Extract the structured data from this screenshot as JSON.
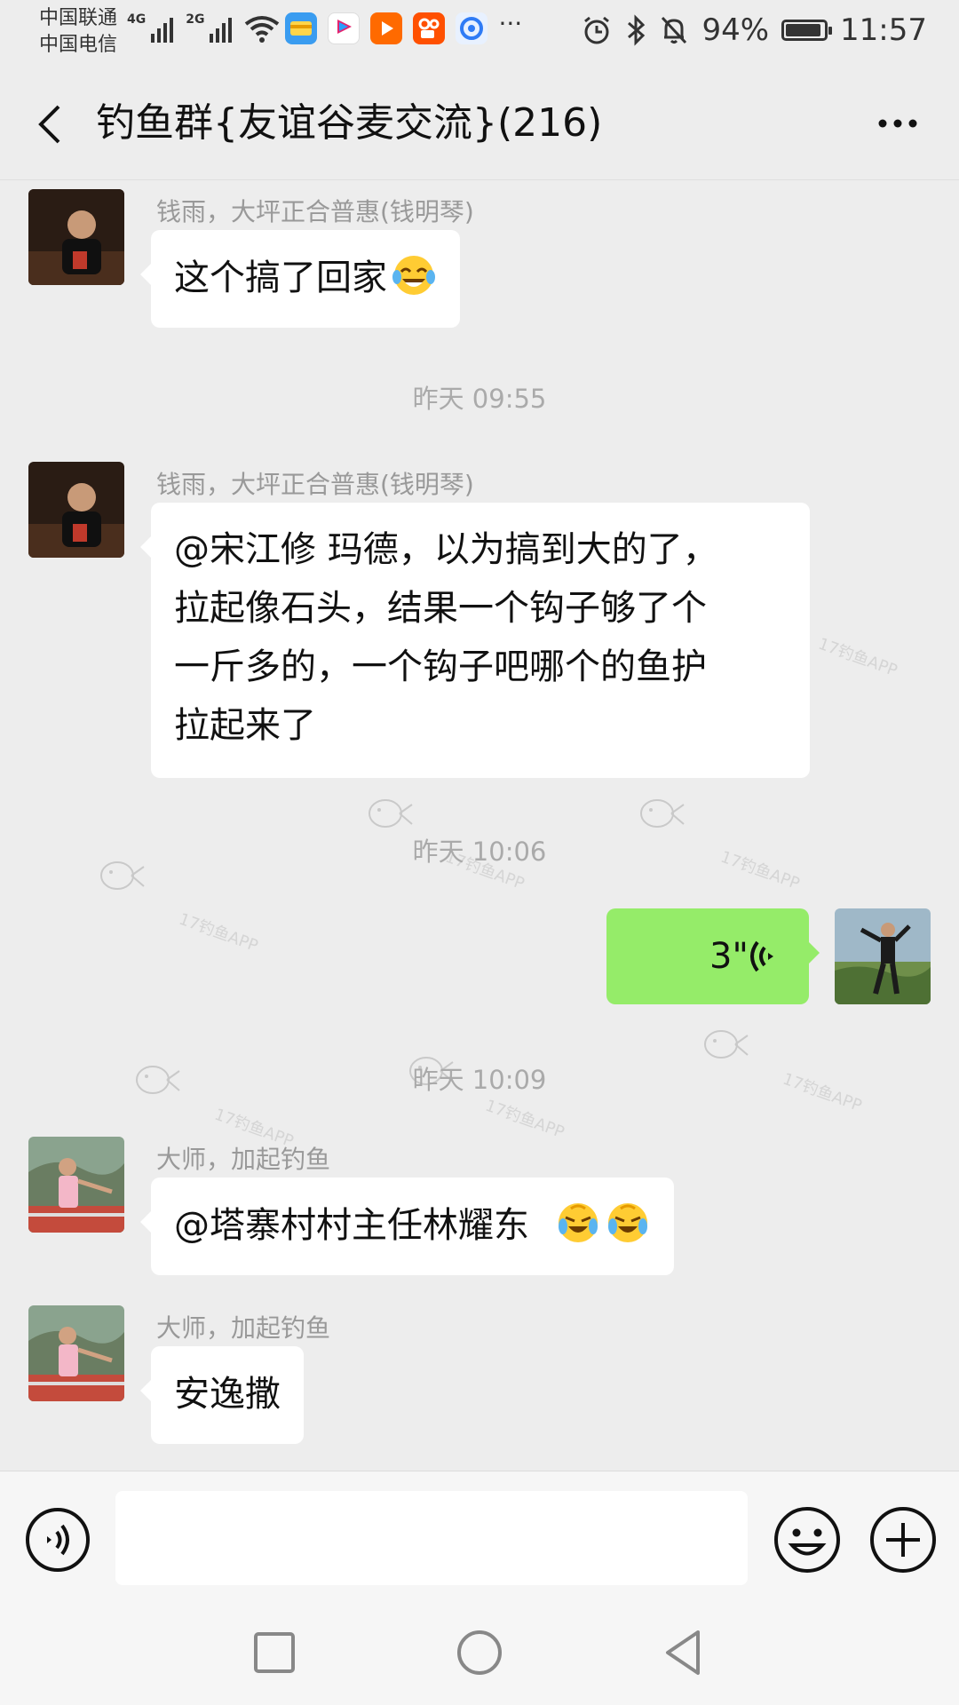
{
  "status_bar": {
    "carrier1": "中国联通",
    "carrier2": "中国电信",
    "net1": "4G",
    "net2": "2G",
    "battery_percent": "94%",
    "battery_level": 0.94,
    "time": "11:57",
    "more_notifications": "···"
  },
  "header": {
    "title": "钓鱼群{友谊谷麦交流}(216)"
  },
  "messages": [
    {
      "sender": "钱雨，大坪正合普惠(钱明琴)",
      "text": "这个搞了回家",
      "emoji": "tears-of-joy-emoji"
    },
    {
      "timestamp": "昨天 09:55"
    },
    {
      "sender": "钱雨，大坪正合普惠(钱明琴)",
      "lines": [
        "@宋江修  玛德，以为搞到大的了，",
        "拉起像石头，结果一个钩子够了个",
        "一斤多的，一个钩子吧哪个的鱼护",
        "拉起来了"
      ]
    },
    {
      "timestamp": "昨天 10:06"
    },
    {
      "outgoing_voice_duration": "3\""
    },
    {
      "timestamp": "昨天 10:09"
    },
    {
      "sender": "大师，加起钓鱼",
      "text": "@塔寨村村主任林耀东  ",
      "emoji": "loudly-crying-laughing-emoji"
    },
    {
      "sender": "大师，加起钓鱼",
      "text": "安逸撒"
    }
  ],
  "watermark": {
    "text": "17钓鱼APP"
  },
  "input_bar": {
    "value": "",
    "placeholder": ""
  },
  "colors": {
    "background": "#ededed",
    "bubble_in": "#ffffff",
    "bubble_out": "#95ec69",
    "meta_text": "#999999"
  }
}
